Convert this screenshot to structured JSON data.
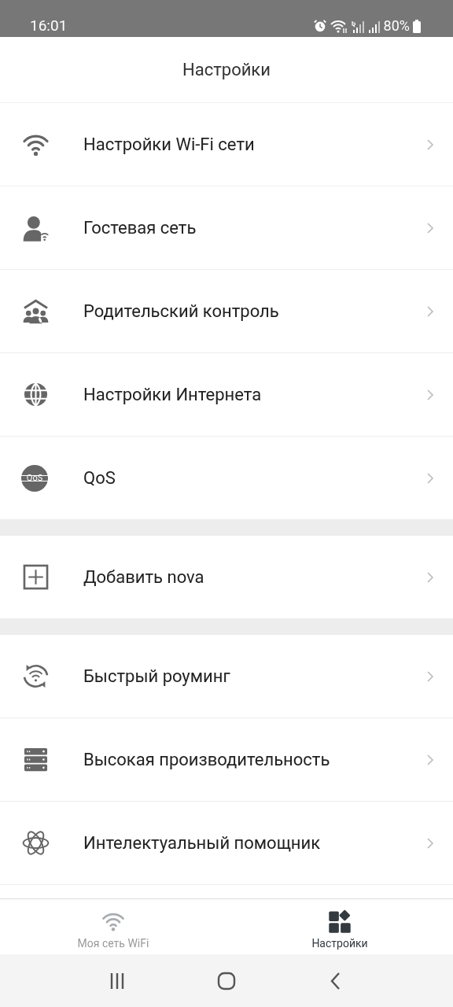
{
  "status_bar": {
    "time": "16:01",
    "battery": "80%"
  },
  "header": {
    "title": "Настройки"
  },
  "groups": [
    [
      {
        "kind": "wifi",
        "label": "Настройки Wi-Fi сети"
      },
      {
        "kind": "guest",
        "label": "Гостевая сеть"
      },
      {
        "kind": "family",
        "label": "Родительский контроль"
      },
      {
        "kind": "globe",
        "label": "Настройки Интернета"
      },
      {
        "kind": "qos",
        "label": "QoS",
        "icon_text": "QoS"
      }
    ],
    [
      {
        "kind": "plus",
        "label": "Добавить nova"
      }
    ],
    [
      {
        "kind": "roaming",
        "label": "Быстрый роуминг"
      },
      {
        "kind": "server",
        "label": "Высокая производительность"
      },
      {
        "kind": "atom",
        "label": "Интелектуальный помощник"
      }
    ]
  ],
  "bottom_nav": [
    {
      "kind": "wifi",
      "label": "Моя сеть WiFi",
      "selected": false
    },
    {
      "kind": "grid",
      "label": "Настройки",
      "selected": true
    }
  ]
}
